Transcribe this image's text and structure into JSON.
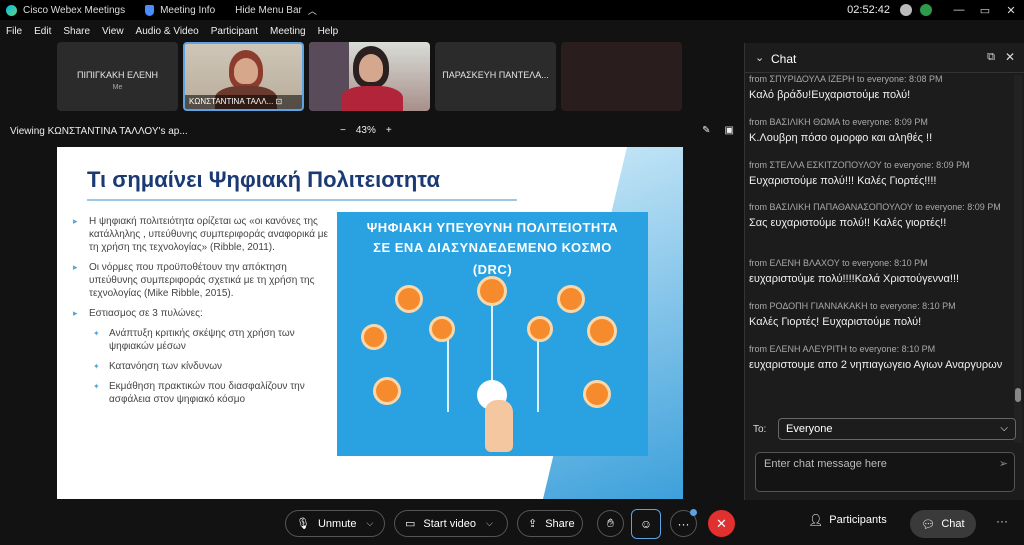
{
  "titlebar": {
    "app_name": "Cisco Webex Meetings",
    "meeting_info": "Meeting Info",
    "hide_menu": "Hide Menu Bar",
    "clock": "02:52:42",
    "win_min": "—",
    "win_max": "▭",
    "win_close": "✕"
  },
  "menu": {
    "items": [
      "File",
      "Edit",
      "Share",
      "View",
      "Audio & Video",
      "Participant",
      "Meeting",
      "Help"
    ]
  },
  "participants": [
    {
      "name": "ΠΙΠΙΓΚΑΚΗ ΕΛΕΝΗ",
      "sub": "Me"
    },
    {
      "name": "ΚΩΝΣΤΑΝΤΙΝΑ ΤΑΛΛ..."
    },
    {
      "name": ""
    },
    {
      "name": "ΠΑΡΑΣΚΕΥΗ ΠΑΝΤΕΛΑ..."
    }
  ],
  "viewing": {
    "title": "Viewing ΚΩΝΣΤΑΝΤΙΝΑ ΤΑΛΛΟΥ's ap...",
    "zoom_minus": "−",
    "zoom_level": "43%",
    "zoom_plus": "+"
  },
  "slide": {
    "title": "Τι σημαίνει Ψηφιακή Πολιτειοτητα",
    "bullets": [
      "Η ψηφιακή πολιτειότητα ορίζεται ως «οι κανόνες της κατάλληλης , υπεύθυνης συμπεριφοράς αναφορικά με τη χρήση της τεχνολογίας» (Ribble, 2011).",
      "Οι νόρμες που προϋποθέτουν την απόκτηση υπεύθυνης συμπεριφοράς σχετικά με τη χρήση της τεχνολογίας (Mike Ribble, 2015).",
      "Εστιασμος σε 3 πυλώνες:"
    ],
    "subbullets": [
      "Ανάπτυξη κριτικής σκέψης στη χρήση των ψηφιακών μέσων",
      "Κατανόηση των κίνδυνων",
      "Εκμάθηση πρακτικών που διασφαλίζουν την ασφάλεια στον ψηφιακό κόσμο"
    ],
    "panel_line1": "ΨΗΦΙΑΚΗ ΥΠΕΥΘΥΝΗ ΠΟΛΙΤΕΙΟΤΗΤΑ",
    "panel_line2": "ΣΕ ΕΝΑ ΔΙΑΣΥΝΔΕΔΕΜΕΝΟ ΚΟΣΜΟ",
    "panel_line3": "(DRC)"
  },
  "chat": {
    "title": "Chat",
    "messages": [
      {
        "meta": "from ΣΠΥΡΙΔΟΥΛΑ ΙΖΕΡΗ to everyone:    8:08 PM",
        "text": "Καλό βράδυ!Ευχαριστούμε πολύ!"
      },
      {
        "meta": "from ΒΑΣΙΛΙΚΗ ΘΩΜΑ to everyone:     8:09 PM",
        "text": "Κ.Λουβρη πόσο ομορφο και αληθές !!"
      },
      {
        "meta": "from ΣΤΕΛΛΑ ΕΣΚΙΤΖΟΠΟΥΛΟΥ to everyone:     8:09 PM",
        "text": "Ευχαριστούμε πολύ!!! Καλές Γιορτές!!!!"
      },
      {
        "meta": "from ΒΑΣΙΛΙΚΗ ΠΑΠΑΘΑΝΑΣΟΠΟΥΛΟΥ to everyone: 8:09 PM",
        "text": "Σας ευχαριστούμε πολύ!! Καλές γιορτές!!"
      },
      {
        "meta": "from ΕΛΕΝΗ ΒΛΑΧΟΥ to everyone:     8:10 PM",
        "text": "ευχαριστούμε πολύ!!!!Καλά Χριστούγεννα!!!"
      },
      {
        "meta": "from ΡΟΔΟΠΗ ΓΙΑΝΝΑΚΑΚΗ to everyone:     8:10 PM",
        "text": "Καλές Γιορτές! Ευχαριστούμε πολύ!"
      },
      {
        "meta": "from ΕΛΕΝΗ ΑΛΕΥΡΙΤΗ to everyone:     8:10 PM",
        "text": "ευχαριστουμε απο 2 νηπιαγωγειο Αγιων Αναργυρων"
      }
    ],
    "to_label": "To:",
    "to_value": "Everyone",
    "input_placeholder": "Enter chat message here"
  },
  "controls": {
    "unmute": "Unmute",
    "start_video": "Start video",
    "share": "Share",
    "more": "···",
    "participants": "Participants",
    "chat": "Chat",
    "more_right": "···",
    "end_color": "#e0302f",
    "accent": "#5ca3e6"
  }
}
